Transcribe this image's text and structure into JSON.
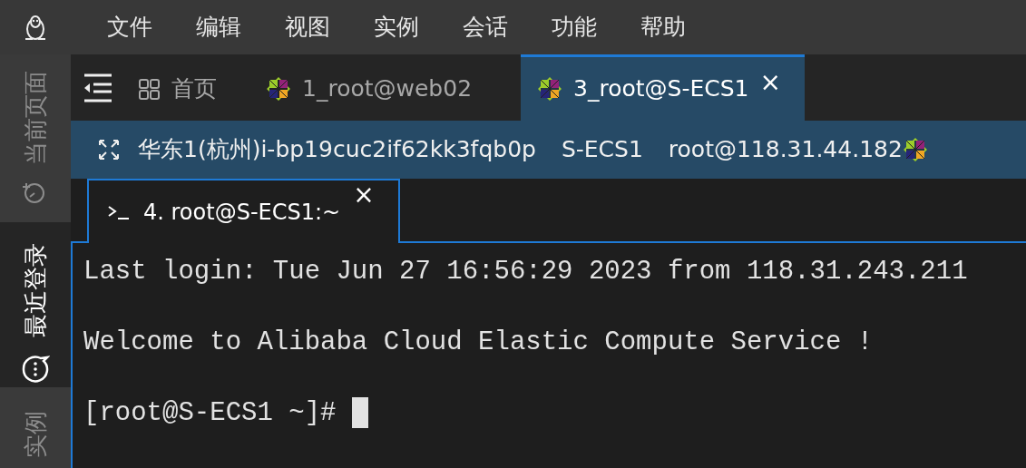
{
  "menu": [
    "文件",
    "编辑",
    "视图",
    "实例",
    "会话",
    "功能",
    "帮助"
  ],
  "sidebar": {
    "items": [
      {
        "label": "当前页面",
        "kind": "current",
        "selected": false
      },
      {
        "label": "最近登录",
        "kind": "recent",
        "selected": true
      },
      {
        "label": "实例",
        "kind": "instances",
        "selected": false
      }
    ]
  },
  "tabs": [
    {
      "label": "首页",
      "kind": "home",
      "selected": false
    },
    {
      "label": "1_root@web02",
      "kind": "session",
      "selected": false
    },
    {
      "label": "3_root@S-ECS1",
      "kind": "session",
      "selected": true,
      "close": "×"
    }
  ],
  "info_bar": {
    "region": "华东1(杭州)i-bp19cuc2if62kk3fqb0p",
    "host": "S-ECS1",
    "login": "root@118.31.44.182"
  },
  "terminal_tabs": [
    {
      "label": "4. root@S-ECS1:~",
      "selected": true,
      "close": "×"
    }
  ],
  "terminal": {
    "lines": [
      "Last login: Tue Jun 27 16:56:29 2023 from 118.31.243.211",
      "Welcome to Alibaba Cloud Elastic Compute Service !"
    ],
    "prompt": "[root@S-ECS1 ~]#"
  }
}
